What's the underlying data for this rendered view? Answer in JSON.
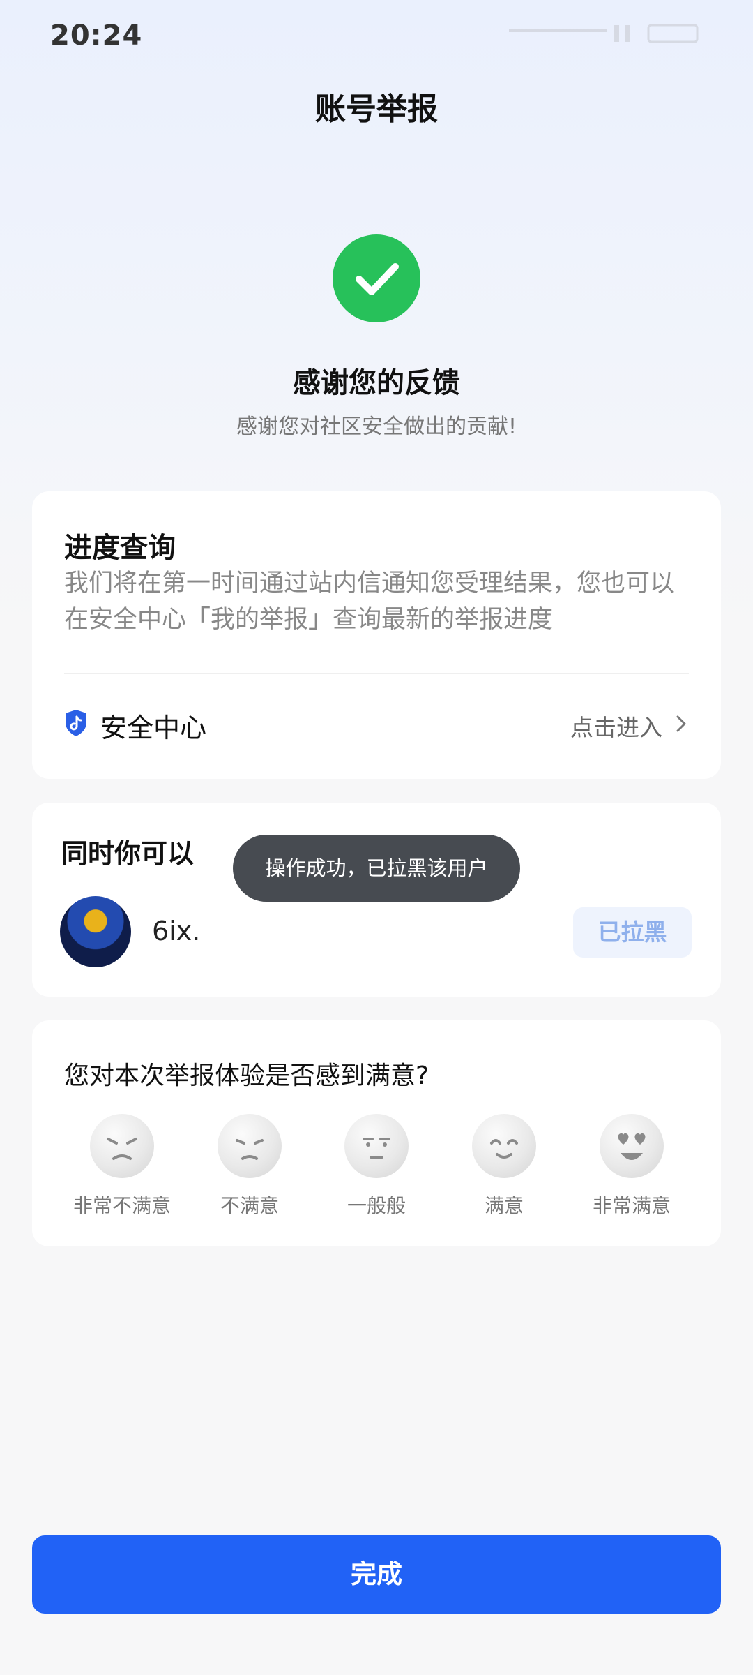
{
  "status_bar": {
    "time": "20:24"
  },
  "page": {
    "title": "账号举报"
  },
  "success": {
    "icon": "check-circle-icon",
    "color": "#27c15a",
    "title": "感谢您的反馈",
    "subtitle": "感谢您对社区安全做出的贡献!"
  },
  "progress_card": {
    "title": "进度查询",
    "description": "我们将在第一时间通过站内信通知您受理结果，您也可以在安全中心「我的举报」查询最新的举报进度",
    "security_center": {
      "icon": "shield-icon",
      "label": "安全中心",
      "action": "点击进入"
    }
  },
  "also_card": {
    "title": "同时你可以",
    "user": {
      "name": "6ix."
    },
    "blocked_label": "已拉黑"
  },
  "toast": {
    "text": "操作成功，已拉黑该用户"
  },
  "rating_card": {
    "question": "您对本次举报体验是否感到满意?",
    "options": [
      {
        "label": "非常不满意",
        "icon": "very-dissatisfied-face-icon"
      },
      {
        "label": "不满意",
        "icon": "dissatisfied-face-icon"
      },
      {
        "label": "一般般",
        "icon": "neutral-face-icon"
      },
      {
        "label": "满意",
        "icon": "satisfied-face-icon"
      },
      {
        "label": "非常满意",
        "icon": "very-satisfied-face-icon"
      }
    ]
  },
  "footer": {
    "done_label": "完成",
    "accent": "#2162f6"
  }
}
